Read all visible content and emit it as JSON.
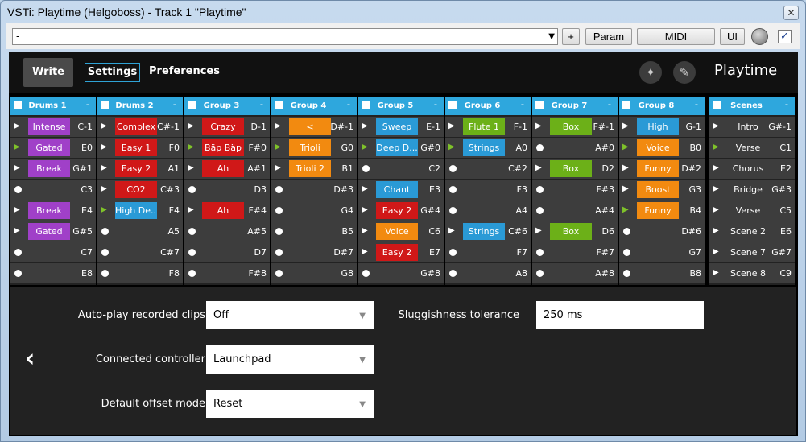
{
  "window": {
    "title": "VSTi: Playtime (Helgoboss) - Track 1 \"Playtime\"",
    "close": "✕"
  },
  "toolbar": {
    "preset": "-",
    "plus": "+",
    "param": "Param",
    "midi": "MIDI",
    "ui": "UI",
    "checked": "✓"
  },
  "header": {
    "write": "Write",
    "settings": "Settings",
    "preferences": "Preferences",
    "title": "Playtime"
  },
  "columns": [
    {
      "name": "Drums 1",
      "slots": [
        [
          "play",
          "Intense",
          "#a040c8",
          "C-1"
        ],
        [
          "gplay",
          "Gated",
          "#a040c8",
          "E0"
        ],
        [
          "play",
          "Break",
          "#a040c8",
          "G#1"
        ],
        [
          "dot",
          "",
          "",
          "C3"
        ],
        [
          "play",
          "Break",
          "#a040c8",
          "E4"
        ],
        [
          "play",
          "Gated",
          "#a040c8",
          "G#5"
        ],
        [
          "dot",
          "",
          "",
          "C7"
        ],
        [
          "dot",
          "",
          "",
          "E8"
        ]
      ]
    },
    {
      "name": "Drums 2",
      "slots": [
        [
          "play",
          "Complex",
          "#d01818",
          "C#-1"
        ],
        [
          "play",
          "Easy 1",
          "#d01818",
          "F0"
        ],
        [
          "play",
          "Easy 2",
          "#d01818",
          "A1"
        ],
        [
          "play",
          "CO2",
          "#d01818",
          "C#3"
        ],
        [
          "gplay",
          "High De...",
          "#2a9ad6",
          "F4"
        ],
        [
          "dot",
          "",
          "",
          "A5"
        ],
        [
          "dot",
          "",
          "",
          "C#7"
        ],
        [
          "dot",
          "",
          "",
          "F8"
        ]
      ]
    },
    {
      "name": "Group 3",
      "slots": [
        [
          "play",
          "Crazy",
          "#d01818",
          "D-1"
        ],
        [
          "gplay",
          "Bäp Bäp",
          "#d01818",
          "F#0"
        ],
        [
          "play",
          "Ah",
          "#d01818",
          "A#1"
        ],
        [
          "dot",
          "",
          "",
          "D3"
        ],
        [
          "play",
          "Ah",
          "#d01818",
          "F#4"
        ],
        [
          "dot",
          "",
          "",
          "A#5"
        ],
        [
          "dot",
          "",
          "",
          "D7"
        ],
        [
          "dot",
          "",
          "",
          "F#8"
        ]
      ]
    },
    {
      "name": "Group 4",
      "slots": [
        [
          "play",
          "<",
          "#f28a10",
          "D#-1"
        ],
        [
          "gplay",
          "Trioli",
          "#f28a10",
          "G0"
        ],
        [
          "play",
          "Trioli 2",
          "#f28a10",
          "B1"
        ],
        [
          "dot",
          "",
          "",
          "D#3"
        ],
        [
          "dot",
          "",
          "",
          "G4"
        ],
        [
          "dot",
          "",
          "",
          "B5"
        ],
        [
          "dot",
          "",
          "",
          "D#7"
        ],
        [
          "dot",
          "",
          "",
          "G8"
        ]
      ]
    },
    {
      "name": "Group 5",
      "slots": [
        [
          "play",
          "Sweep",
          "#2a9ad6",
          "E-1"
        ],
        [
          "gplay",
          "Deep D...",
          "#2a9ad6",
          "G#0"
        ],
        [
          "dot",
          "",
          "",
          "C2"
        ],
        [
          "play",
          "Chant",
          "#2a9ad6",
          "E3"
        ],
        [
          "play",
          "Easy 2",
          "#d01818",
          "G#4"
        ],
        [
          "play",
          "Voice",
          "#f28a10",
          "C6"
        ],
        [
          "play",
          "Easy 2",
          "#d01818",
          "E7"
        ],
        [
          "dot",
          "",
          "",
          "G#8"
        ]
      ]
    },
    {
      "name": "Group 6",
      "slots": [
        [
          "play",
          "Flute 1",
          "#6cb018",
          "F-1"
        ],
        [
          "gplay",
          "Strings",
          "#2a9ad6",
          "A0"
        ],
        [
          "dot",
          "",
          "",
          "C#2"
        ],
        [
          "dot",
          "",
          "",
          "F3"
        ],
        [
          "dot",
          "",
          "",
          "A4"
        ],
        [
          "play",
          "Strings",
          "#2a9ad6",
          "C#6"
        ],
        [
          "dot",
          "",
          "",
          "F7"
        ],
        [
          "dot",
          "",
          "",
          "A8"
        ]
      ]
    },
    {
      "name": "Group 7",
      "slots": [
        [
          "play",
          "Box",
          "#6cb018",
          "F#-1"
        ],
        [
          "dot",
          "",
          "",
          "A#0"
        ],
        [
          "play",
          "Box",
          "#6cb018",
          "D2"
        ],
        [
          "dot",
          "",
          "",
          "F#3"
        ],
        [
          "dot",
          "",
          "",
          "A#4"
        ],
        [
          "play",
          "Box",
          "#6cb018",
          "D6"
        ],
        [
          "dot",
          "",
          "",
          "F#7"
        ],
        [
          "dot",
          "",
          "",
          "A#8"
        ]
      ]
    },
    {
      "name": "Group 8",
      "slots": [
        [
          "play",
          "High",
          "#2a9ad6",
          "G-1"
        ],
        [
          "gplay",
          "Voice",
          "#f28a10",
          "B0"
        ],
        [
          "play",
          "Funny",
          "#f28a10",
          "D#2"
        ],
        [
          "play",
          "Boost",
          "#f28a10",
          "G3"
        ],
        [
          "gplay",
          "Funny",
          "#f28a10",
          "B4"
        ],
        [
          "dot",
          "",
          "",
          "D#6"
        ],
        [
          "dot",
          "",
          "",
          "G7"
        ],
        [
          "dot",
          "",
          "",
          "B8"
        ]
      ]
    }
  ],
  "scenes": {
    "name": "Scenes",
    "slots": [
      [
        "play",
        "Intro",
        "G#-1"
      ],
      [
        "gplay",
        "Verse",
        "C1"
      ],
      [
        "play",
        "Chorus",
        "E2"
      ],
      [
        "play",
        "Bridge",
        "G#3"
      ],
      [
        "play",
        "Verse",
        "C5"
      ],
      [
        "play",
        "Scene 2",
        "E6"
      ],
      [
        "play",
        "Scene 7",
        "G#7"
      ],
      [
        "play",
        "Scene 8",
        "C9"
      ]
    ]
  },
  "settings": {
    "autoplay_label": "Auto-play recorded clips",
    "autoplay_value": "Off",
    "controller_label": "Connected controller",
    "controller_value": "Launchpad",
    "offset_label": "Default offset mode",
    "offset_value": "Reset",
    "sluggish_label": "Sluggishness tolerance",
    "sluggish_value": "250 ms"
  }
}
